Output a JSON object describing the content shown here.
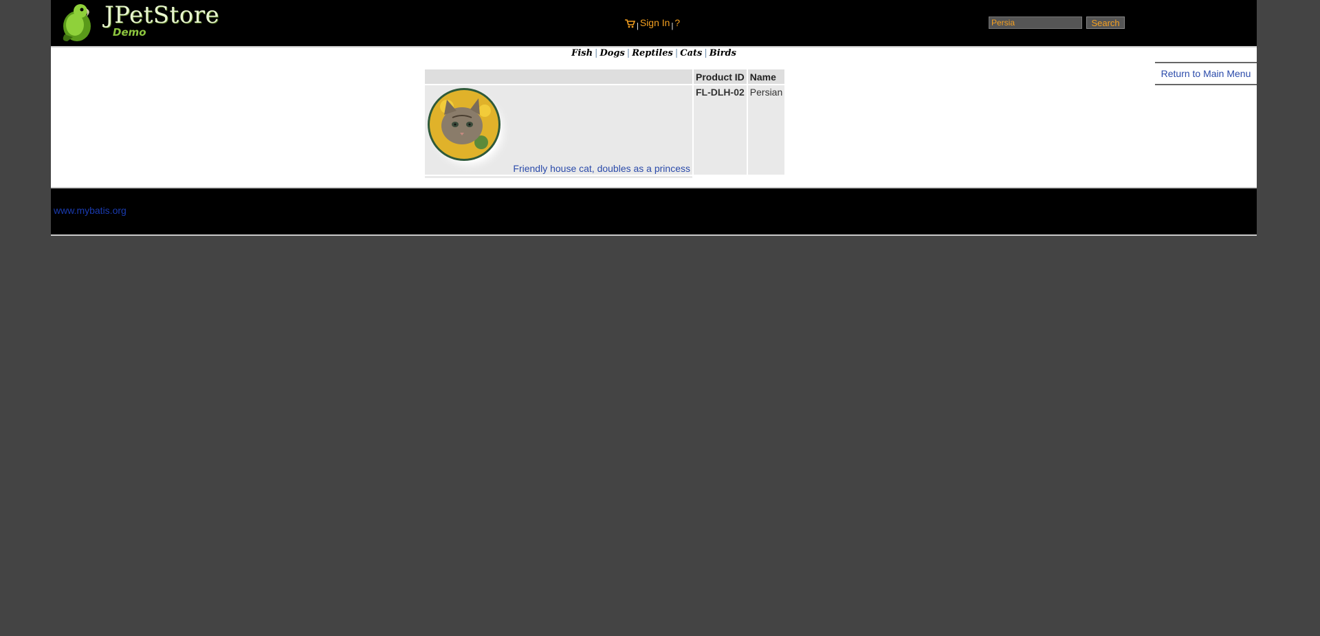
{
  "header": {
    "logo_title": "JPetStore",
    "logo_subtitle": "Demo",
    "sign_in": "Sign In",
    "help": "?",
    "separator": "|",
    "search_value": "Persia",
    "search_button": "Search"
  },
  "quicklinks": [
    "Fish",
    "Dogs",
    "Reptiles",
    "Cats",
    "Birds"
  ],
  "back_link": "Return to Main Menu",
  "table": {
    "headers": [
      "",
      "Product ID",
      "Name"
    ],
    "rows": [
      {
        "description": "Friendly house cat, doubles as a princess",
        "product_id": "FL-DLH-02",
        "name": "Persian"
      }
    ]
  },
  "footer": {
    "link": "www.mybatis.org"
  },
  "colors": {
    "background": "#444444",
    "header": "#000000",
    "accent": "#f5a020",
    "link": "#2a4aaa"
  }
}
